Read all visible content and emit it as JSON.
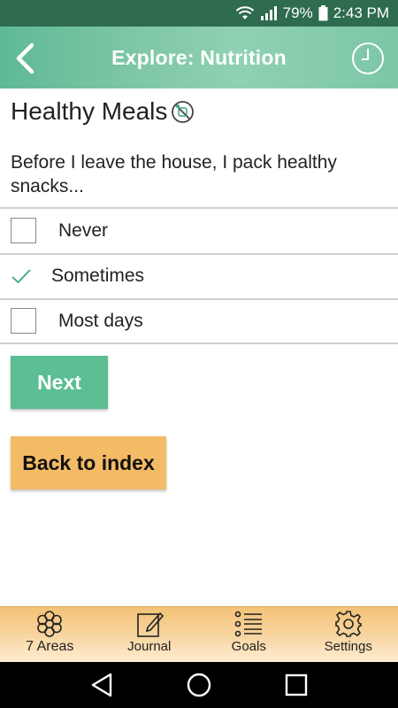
{
  "status_bar": {
    "battery": "79%",
    "time": "2:43 PM"
  },
  "header": {
    "title": "Explore: Nutrition"
  },
  "section": {
    "title": "Healthy Meals"
  },
  "question": {
    "text": "Before I leave the house, I pack healthy snacks..."
  },
  "options": [
    {
      "label": "Never",
      "checked": false
    },
    {
      "label": "Sometimes",
      "checked": true
    },
    {
      "label": "Most days",
      "checked": false
    }
  ],
  "buttons": {
    "next": "Next",
    "back_to_index": "Back to index"
  },
  "bottom_nav": {
    "items": [
      {
        "label": "7 Areas",
        "icon": "flower-icon"
      },
      {
        "label": "Journal",
        "icon": "journal-icon"
      },
      {
        "label": "Goals",
        "icon": "list-icon"
      },
      {
        "label": "Settings",
        "icon": "gear-icon"
      }
    ]
  },
  "colors": {
    "status_bar": "#2e6b4f",
    "header": "#7cc6a6",
    "next_button": "#5cbe92",
    "back_button": "#f4bb66",
    "check": "#3aa67c"
  }
}
